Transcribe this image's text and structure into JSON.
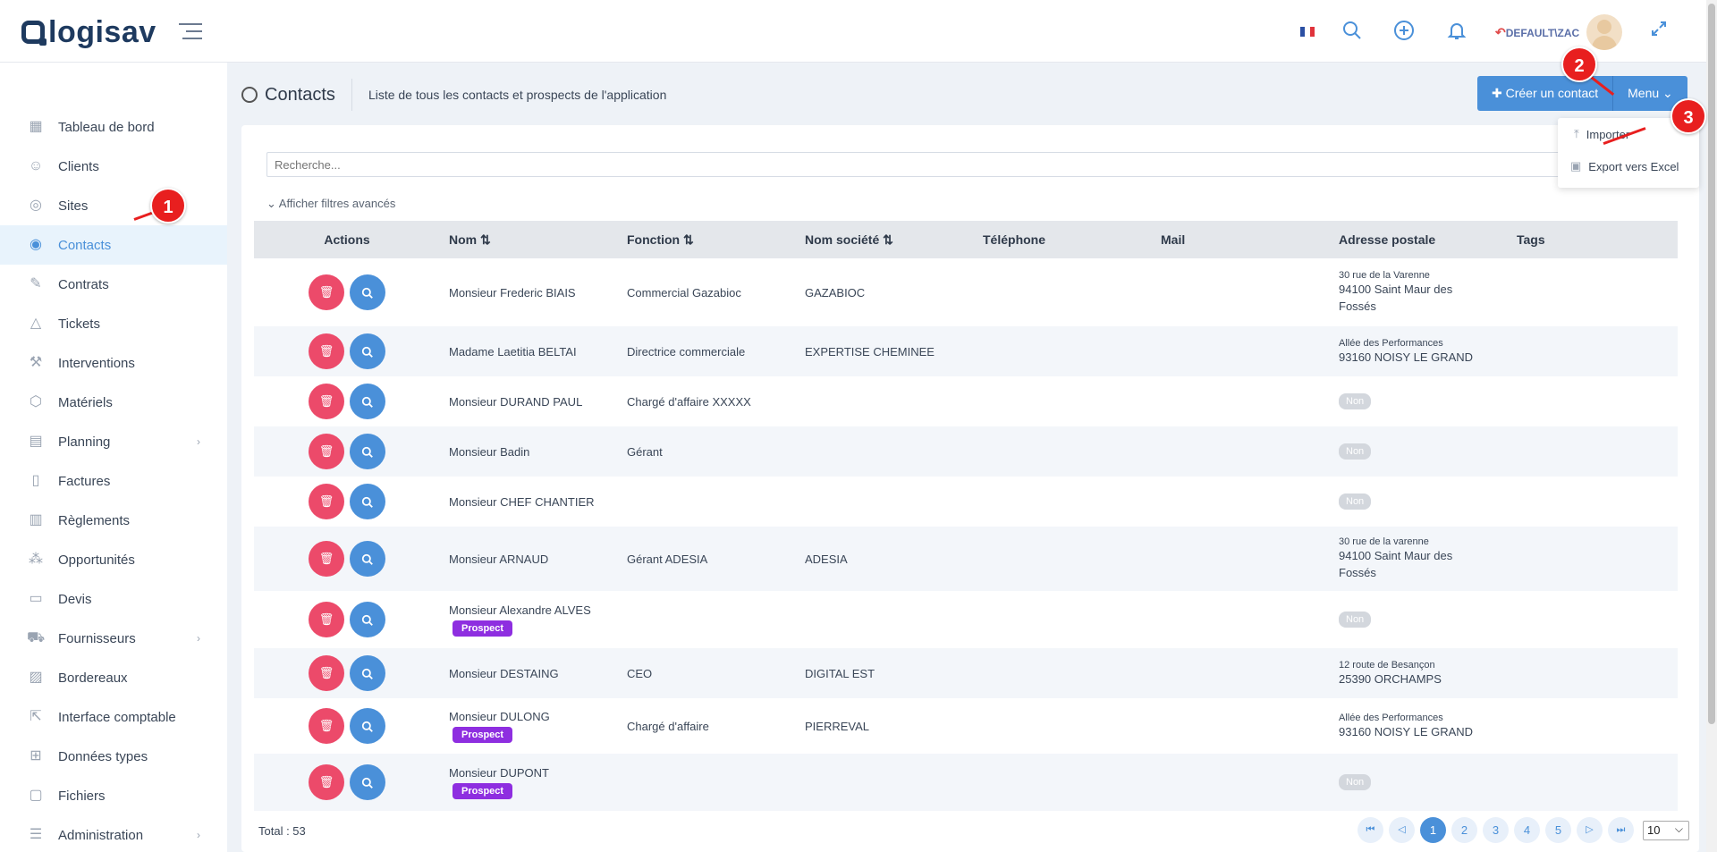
{
  "header": {
    "logo_text": "logisav",
    "user_label": "DEFAULT\\ZAC"
  },
  "sidebar": {
    "items": [
      {
        "label": "Tableau de bord",
        "icon": "dashboard-icon"
      },
      {
        "label": "Clients",
        "icon": "users-icon"
      },
      {
        "label": "Sites",
        "icon": "location-icon"
      },
      {
        "label": "Contacts",
        "icon": "contacts-icon",
        "active": true
      },
      {
        "label": "Contrats",
        "icon": "contract-icon"
      },
      {
        "label": "Tickets",
        "icon": "warning-icon"
      },
      {
        "label": "Interventions",
        "icon": "wrench-icon"
      },
      {
        "label": "Matériels",
        "icon": "cube-icon"
      },
      {
        "label": "Planning",
        "icon": "calendar-icon",
        "has_children": true
      },
      {
        "label": "Factures",
        "icon": "invoice-icon"
      },
      {
        "label": "Règlements",
        "icon": "payment-icon"
      },
      {
        "label": "Opportunités",
        "icon": "network-icon"
      },
      {
        "label": "Devis",
        "icon": "quote-icon"
      },
      {
        "label": "Fournisseurs",
        "icon": "truck-icon",
        "has_children": true
      },
      {
        "label": "Bordereaux",
        "icon": "slip-icon"
      },
      {
        "label": "Interface comptable",
        "icon": "external-link-icon"
      },
      {
        "label": "Données types",
        "icon": "grid-icon"
      },
      {
        "label": "Fichiers",
        "icon": "file-icon"
      },
      {
        "label": "Administration",
        "icon": "admin-icon",
        "has_children": true
      }
    ]
  },
  "page": {
    "title": "Contacts",
    "subtitle": "Liste de tous les contacts et prospects de l'application",
    "create_button": "Créer un contact",
    "menu_button": "Menu",
    "dropdown": {
      "import": "Importer",
      "export": "Export vers Excel"
    },
    "search_placeholder": "Recherche...",
    "filters_label": "Afficher filtres avancés"
  },
  "table": {
    "headers": {
      "actions": "Actions",
      "nom": "Nom",
      "fonction": "Fonction",
      "societe": "Nom société",
      "telephone": "Téléphone",
      "mail": "Mail",
      "adresse": "Adresse postale",
      "tags": "Tags"
    },
    "rows": [
      {
        "nom": "Monsieur Frederic BIAIS",
        "prospect": false,
        "fonction": "Commercial Gazabioc",
        "societe": "GAZABIOC",
        "addr1": "30 rue de la Varenne",
        "addr2": "94100 Saint Maur des",
        "addr3": "Fossés",
        "non": false
      },
      {
        "nom": "Madame Laetitia BELTAI",
        "prospect": false,
        "fonction": "Directrice commerciale",
        "societe": "EXPERTISE CHEMINEE",
        "addr1": "Allée des Performances",
        "addr2": "93160 NOISY LE GRAND",
        "addr3": "",
        "non": false
      },
      {
        "nom": "Monsieur DURAND PAUL",
        "prospect": false,
        "fonction": "Chargé d'affaire XXXXX",
        "societe": "",
        "addr1": "",
        "addr2": "",
        "addr3": "",
        "non": true
      },
      {
        "nom": "Monsieur Badin",
        "prospect": false,
        "fonction": "Gérant",
        "societe": "",
        "addr1": "",
        "addr2": "",
        "addr3": "",
        "non": true
      },
      {
        "nom": "Monsieur CHEF CHANTIER",
        "prospect": false,
        "fonction": "",
        "societe": "",
        "addr1": "",
        "addr2": "",
        "addr3": "",
        "non": true
      },
      {
        "nom": "Monsieur ARNAUD",
        "prospect": false,
        "fonction": "Gérant ADESIA",
        "societe": "ADESIA",
        "addr1": "30 rue de la varenne",
        "addr2": "94100 Saint Maur des",
        "addr3": "Fossés",
        "non": false
      },
      {
        "nom": "Monsieur Alexandre ALVES",
        "prospect": true,
        "fonction": "",
        "societe": "",
        "addr1": "",
        "addr2": "",
        "addr3": "",
        "non": true
      },
      {
        "nom": "Monsieur DESTAING",
        "prospect": false,
        "fonction": "CEO",
        "societe": "DIGITAL EST",
        "addr1": "12 route de Besançon",
        "addr2": "25390 ORCHAMPS",
        "addr3": "",
        "non": false
      },
      {
        "nom": "Monsieur DULONG",
        "prospect": true,
        "fonction": "Chargé d'affaire",
        "societe": "PIERREVAL",
        "addr1": "Allée des Performances",
        "addr2": "93160 NOISY LE GRAND",
        "addr3": "",
        "non": false
      },
      {
        "nom": "Monsieur DUPONT",
        "prospect": true,
        "fonction": "",
        "societe": "",
        "addr1": "",
        "addr2": "",
        "addr3": "",
        "non": true
      }
    ],
    "prospect_label": "Prospect",
    "non_label": "Non"
  },
  "footer": {
    "total": "Total : 53",
    "pages": [
      "1",
      "2",
      "3",
      "4",
      "5"
    ],
    "current_page": "1",
    "page_size": "10"
  },
  "callouts": [
    "1",
    "2",
    "3"
  ],
  "colors": {
    "primary": "#4a90d9",
    "danger": "#ec4a6a",
    "prospect": "#8e2ee0",
    "callout": "#e81f1f"
  }
}
